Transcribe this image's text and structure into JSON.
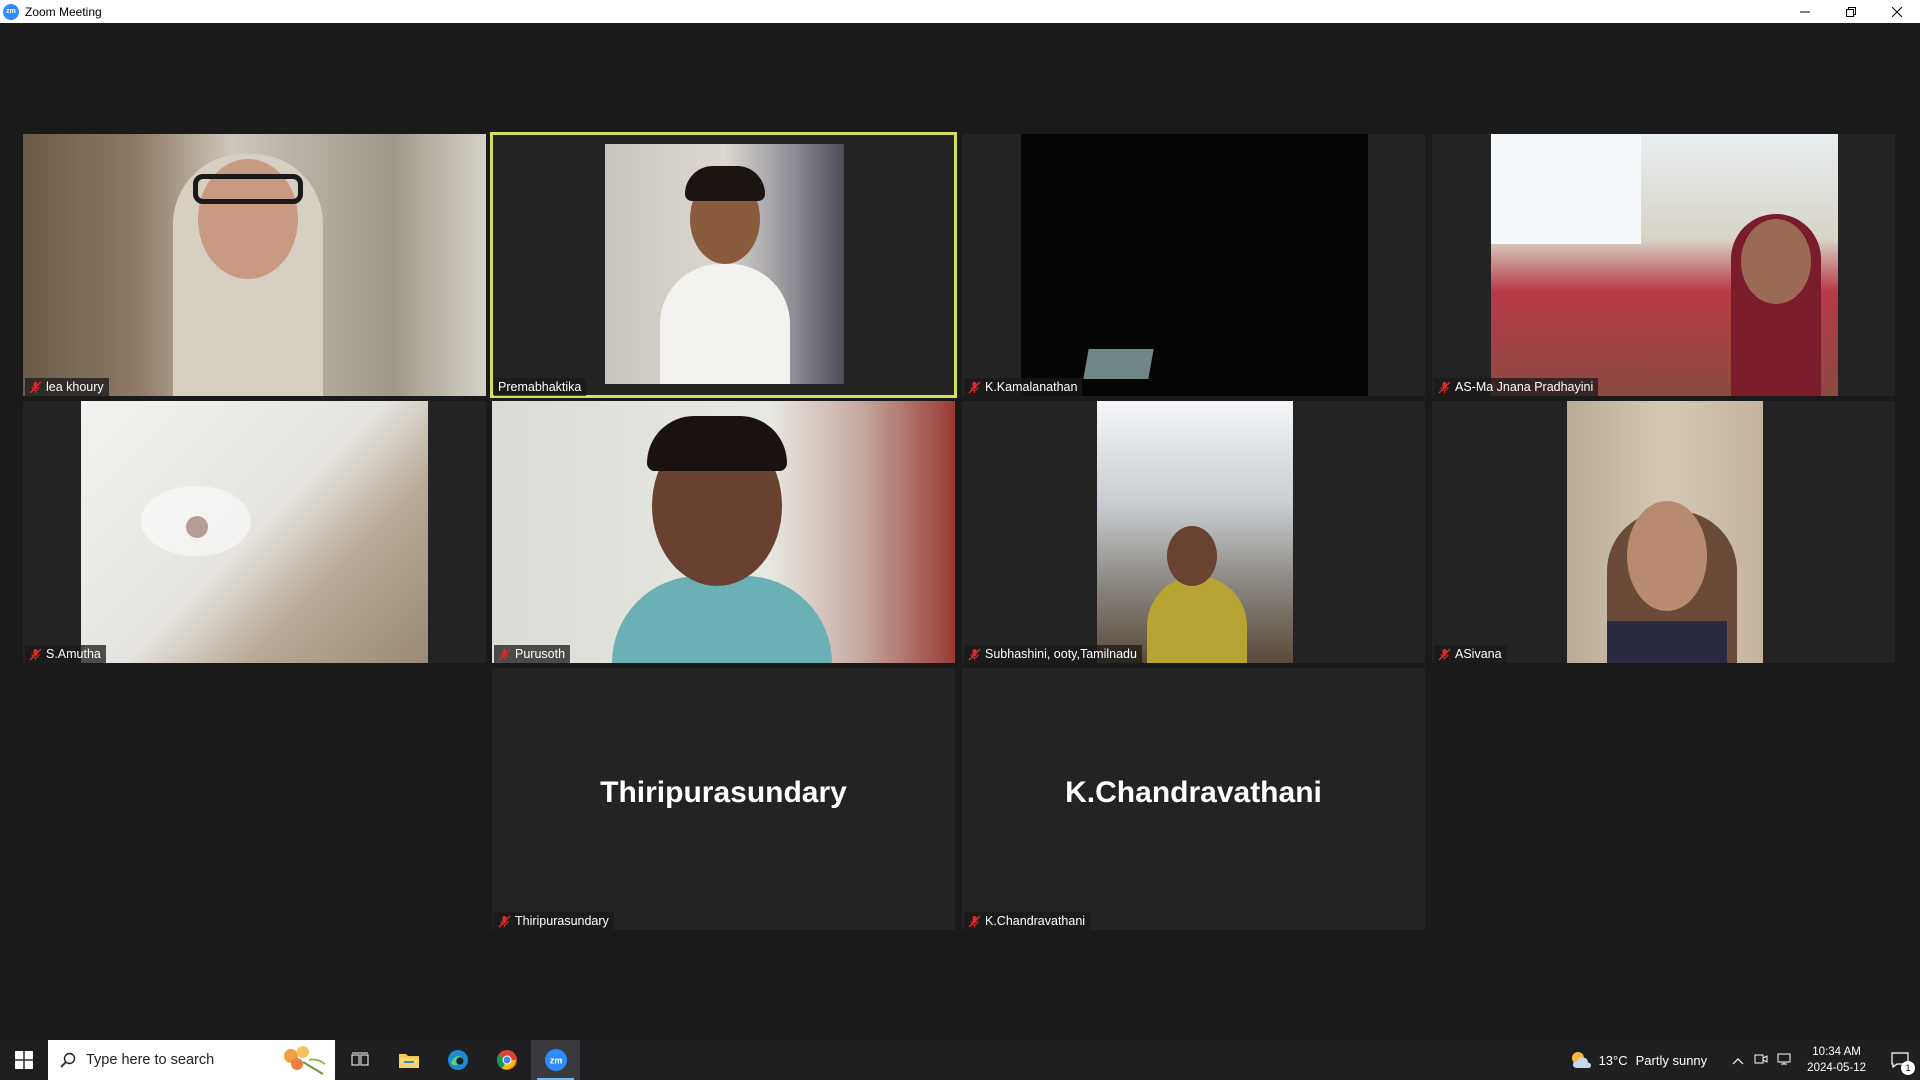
{
  "window": {
    "title": "Zoom Meeting",
    "app_icon": "zoom-logo",
    "logo_text": "zm",
    "controls": [
      "minimize-icon",
      "restore-icon",
      "close-icon"
    ]
  },
  "meeting": {
    "active_speaker": "Premabhaktika",
    "speaker_highlight_color": "#d3e05c",
    "muted_icon_color": "#e02828",
    "tiles": [
      {
        "name": "lea khoury",
        "muted": true,
        "video": true
      },
      {
        "name": "Premabhaktika",
        "muted": false,
        "video": true
      },
      {
        "name": "K.Kamalanathan",
        "muted": true,
        "video": true
      },
      {
        "name": "AS-Ma Jnana Pradhayini",
        "muted": true,
        "video": true
      },
      {
        "name": "S.Amutha",
        "muted": true,
        "video": true
      },
      {
        "name": "Purusoth",
        "muted": true,
        "video": true
      },
      {
        "name": "Subhashini, ooty,Tamilnadu",
        "muted": true,
        "video": true
      },
      {
        "name": "ASivana",
        "muted": true,
        "video": true
      },
      {
        "name": "Thiripurasundary",
        "muted": true,
        "video": false,
        "display_name": "Thiripurasundary"
      },
      {
        "name": "K.Chandravathani",
        "muted": true,
        "video": false,
        "display_name": "K.Chandravathani"
      }
    ]
  },
  "taskbar": {
    "search_placeholder": "Type here to search",
    "pinned": [
      "windows-start-icon",
      "task-view-icon",
      "file-explorer-icon",
      "edge-icon",
      "chrome-icon",
      "zoom-taskbar-icon"
    ],
    "zoom_icon_text": "zm",
    "weather": {
      "temp": "13°C",
      "condition": "Partly sunny"
    },
    "time": "10:34 AM",
    "date": "2024-05-12",
    "notification_count": "1"
  }
}
